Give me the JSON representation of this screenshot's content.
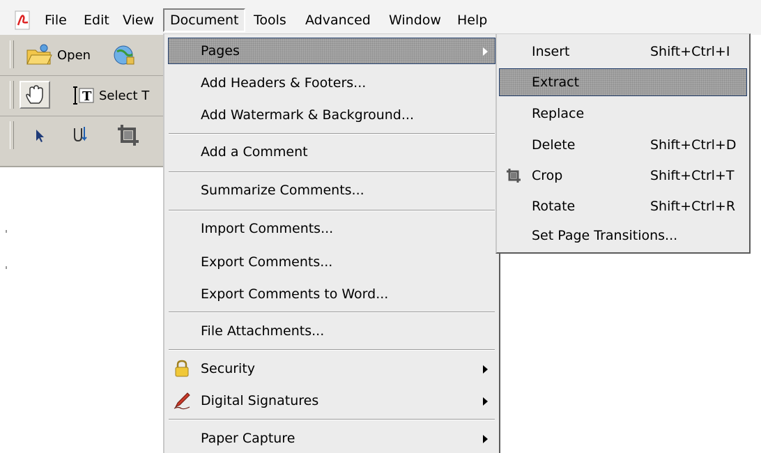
{
  "menubar": {
    "items": [
      {
        "label": "File"
      },
      {
        "label": "Edit"
      },
      {
        "label": "View"
      },
      {
        "label": "Document"
      },
      {
        "label": "Tools"
      },
      {
        "label": "Advanced"
      },
      {
        "label": "Window"
      },
      {
        "label": "Help"
      }
    ]
  },
  "toolbar": {
    "open_label": "Open",
    "select_text_label": "Select T"
  },
  "document_menu": {
    "items": [
      {
        "label": "Pages",
        "submenu": true
      },
      {
        "label": "Add Headers & Footers..."
      },
      {
        "label": "Add Watermark & Background..."
      },
      {
        "label": "Add a Comment"
      },
      {
        "label": "Summarize Comments..."
      },
      {
        "label": "Import Comments..."
      },
      {
        "label": "Export Comments..."
      },
      {
        "label": "Export Comments to Word..."
      },
      {
        "label": "File Attachments..."
      },
      {
        "label": "Security",
        "submenu": true,
        "icon": "lock-icon"
      },
      {
        "label": "Digital Signatures",
        "submenu": true,
        "icon": "pen-icon"
      },
      {
        "label": "Paper Capture",
        "submenu": true
      }
    ]
  },
  "pages_submenu": {
    "items": [
      {
        "label": "Insert",
        "shortcut": "Shift+Ctrl+I"
      },
      {
        "label": "Extract",
        "shortcut": ""
      },
      {
        "label": "Replace",
        "shortcut": ""
      },
      {
        "label": "Delete",
        "shortcut": "Shift+Ctrl+D"
      },
      {
        "label": "Crop",
        "shortcut": "Shift+Ctrl+T",
        "icon": "crop-icon"
      },
      {
        "label": "Rotate",
        "shortcut": "Shift+Ctrl+R"
      },
      {
        "label": "Set Page Transitions...",
        "shortcut": ""
      }
    ]
  },
  "colors": {
    "menu_bg": "#ececec",
    "toolbar_bg": "#d5d2ca",
    "highlight": "#a6a6a6",
    "highlight_border": "#1f3b68"
  }
}
